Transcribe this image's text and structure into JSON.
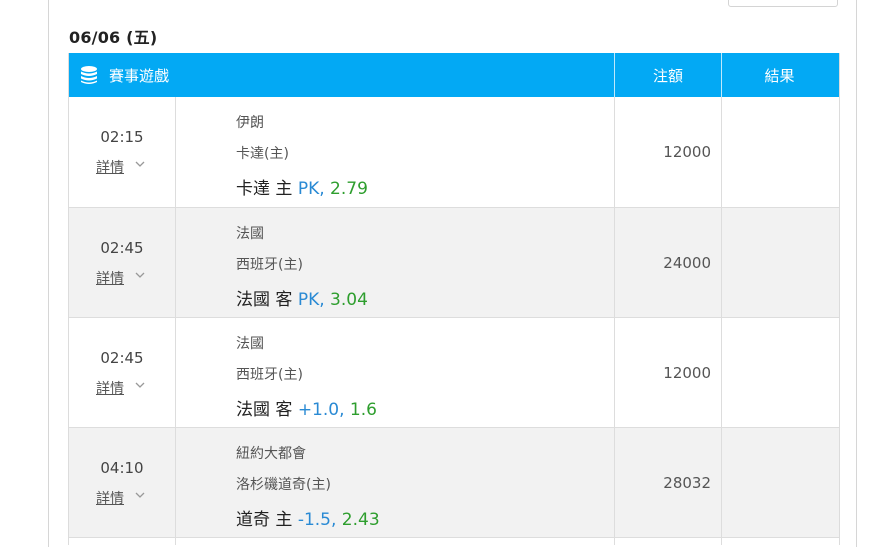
{
  "date_heading": "06/06 (五)",
  "table": {
    "header": {
      "game": "賽事遊戲",
      "stake": "注額",
      "result": "結果"
    },
    "detail_label": "詳情",
    "rows": [
      {
        "time": "02:15",
        "team1": "伊朗",
        "team2": "卡達(主)",
        "pick": "卡達 主",
        "line": "PK,",
        "odds": "2.79",
        "stake": "12000",
        "result": ""
      },
      {
        "time": "02:45",
        "team1": "法國",
        "team2": "西班牙(主)",
        "pick": "法國 客",
        "line": "PK,",
        "odds": "3.04",
        "stake": "24000",
        "result": ""
      },
      {
        "time": "02:45",
        "team1": "法國",
        "team2": "西班牙(主)",
        "pick": "法國 客",
        "line": "+1.0,",
        "odds": "1.6",
        "stake": "12000",
        "result": ""
      },
      {
        "time": "04:10",
        "team1": "紐約大都會",
        "team2": "洛杉磯道奇(主)",
        "pick": "道奇 主",
        "line": "-1.5,",
        "odds": "2.43",
        "stake": "28032",
        "result": ""
      }
    ]
  },
  "colors": {
    "header_bg": "#03a9f4",
    "line_blue": "#2a8ad4",
    "odds_green": "#2e9e2e",
    "alt_row": "#f2f2f2"
  },
  "icons": {
    "header": "database-icon",
    "detail": "chevron-down-icon"
  }
}
